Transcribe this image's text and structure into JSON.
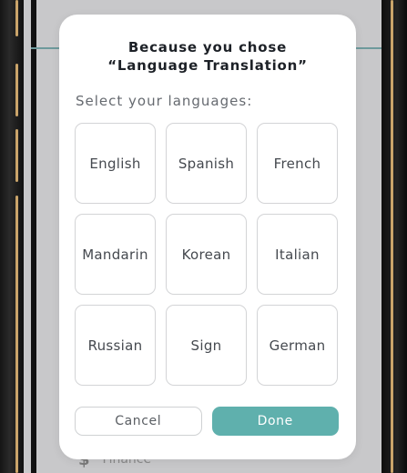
{
  "modal": {
    "title_line1": "Because you chose",
    "title_line2": "“Language Translation”",
    "subtitle": "Select your languages:",
    "languages": [
      "English",
      "Spanish",
      "French",
      "Mandarin",
      "Korean",
      "Italian",
      "Russian",
      "Sign",
      "German"
    ],
    "cancel_label": "Cancel",
    "done_label": "Done"
  },
  "background": {
    "row_icon": "$",
    "row_label": "Finance"
  },
  "colors": {
    "accent": "#5fb0ad",
    "overlay": "#c8c8ca",
    "frame_trim": "#caa46a"
  }
}
